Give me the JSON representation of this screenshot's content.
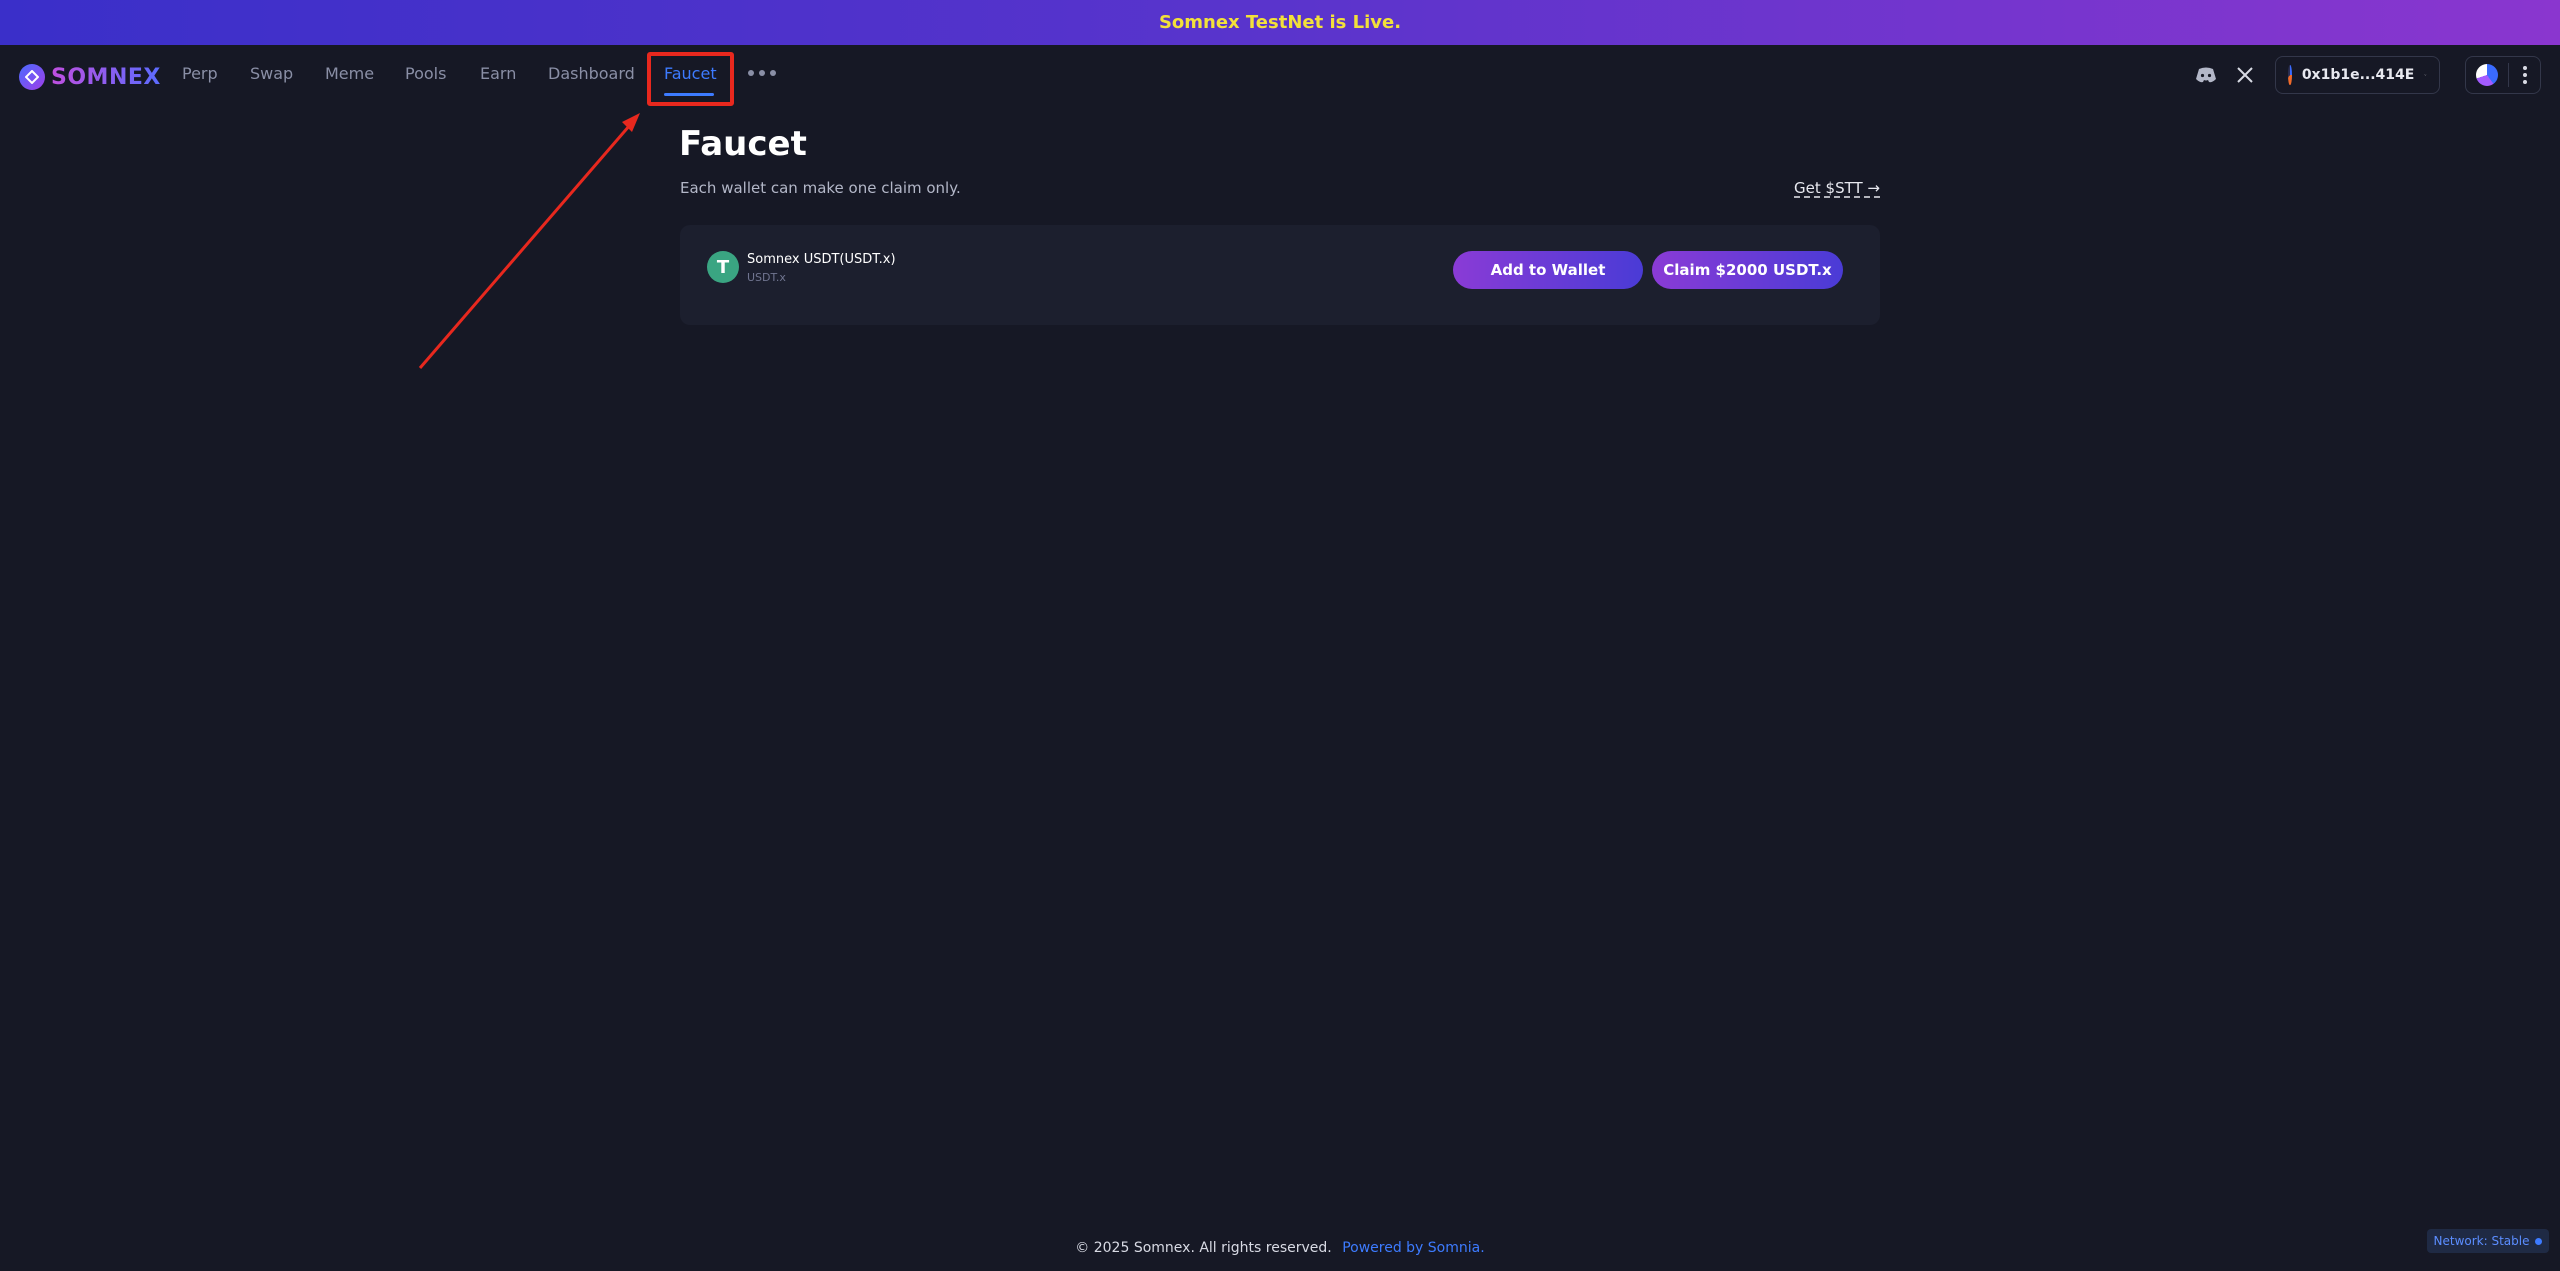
{
  "announcement": "Somnex TestNet is Live.",
  "brand": {
    "name": "SOMNEX"
  },
  "nav": {
    "items": [
      {
        "label": "Perp"
      },
      {
        "label": "Swap"
      },
      {
        "label": "Meme"
      },
      {
        "label": "Pools"
      },
      {
        "label": "Earn"
      },
      {
        "label": "Dashboard"
      },
      {
        "label": "Faucet",
        "active": true
      }
    ]
  },
  "header": {
    "wallet_address": "0x1b1e...414E"
  },
  "faucet": {
    "title": "Faucet",
    "subtitle": "Each wallet can make one claim only.",
    "get_stt_link": "Get $STT →",
    "token": {
      "icon_letter": "T",
      "name": "Somnex USDT(USDT.x)",
      "symbol": "USDT.x"
    },
    "add_to_wallet_label": "Add to Wallet",
    "claim_label": "Claim $2000 USDT.x"
  },
  "footer": {
    "copyright": "© 2025 Somnex. All rights reserved.",
    "powered": "Powered by Somnia."
  },
  "network_badge": "Network: Stable",
  "colors": {
    "accent": "#3d7bff",
    "announcement_text": "#f2e13a",
    "highlight": "#e8281e",
    "background": "#161825"
  }
}
